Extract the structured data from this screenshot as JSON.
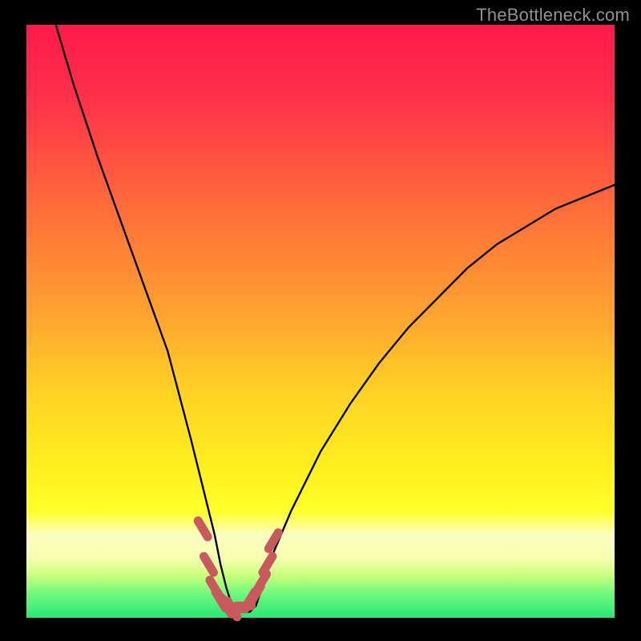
{
  "watermark": "TheBottleneck.com",
  "colors": {
    "border": "#000000",
    "curve": "#000000",
    "marker": "#c85a5e",
    "green_band": "#2fe477",
    "yellow_band": "#fbfec0"
  },
  "chart_data": {
    "type": "line",
    "title": "",
    "xlabel": "",
    "ylabel": "",
    "xlim": [
      0,
      100
    ],
    "ylim": [
      0,
      100
    ],
    "grid": false,
    "legend": false,
    "series": [
      {
        "name": "bottleneck-curve",
        "x": [
          5,
          8,
          12,
          16,
          20,
          24,
          28,
          30,
          32,
          33,
          34,
          35,
          36,
          37,
          38,
          39,
          40,
          42,
          45,
          50,
          55,
          60,
          65,
          70,
          75,
          80,
          85,
          90,
          95,
          100
        ],
        "y": [
          100,
          90,
          78,
          67,
          56,
          45,
          30,
          22,
          14,
          9,
          5,
          2,
          1,
          1,
          1,
          2,
          5,
          11,
          18,
          28,
          36,
          43,
          49,
          54,
          59,
          63,
          66,
          69,
          71,
          73
        ]
      }
    ],
    "markers": {
      "name": "highlight-segments",
      "x": [
        30,
        31,
        32,
        33,
        34,
        35,
        36,
        37,
        38,
        39,
        40,
        41,
        42
      ],
      "y": [
        15,
        9,
        5,
        3,
        2,
        1.5,
        1.5,
        2,
        3,
        4,
        6,
        9,
        13
      ]
    },
    "bands": [
      {
        "name": "pale-yellow",
        "y0": 15,
        "y1": 22
      },
      {
        "name": "green-bottom",
        "y0": 0,
        "y1": 4
      }
    ]
  }
}
